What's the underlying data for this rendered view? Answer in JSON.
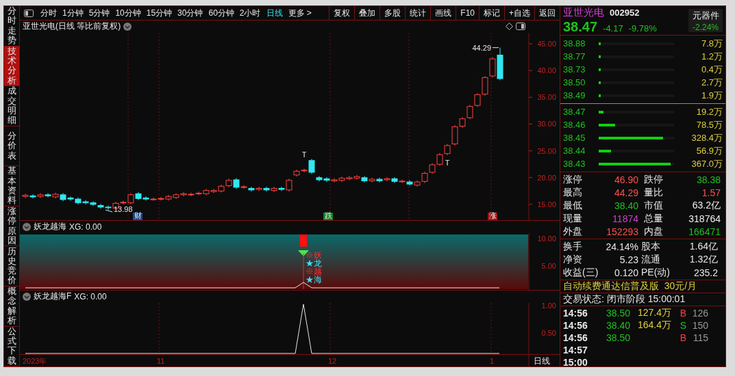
{
  "side_tabs": [
    {
      "label": "分时走势",
      "selected": false
    },
    {
      "label": "技术分析",
      "selected": true
    },
    {
      "label": "成交明细",
      "selected": false
    },
    {
      "label": "分价表",
      "selected": false
    },
    {
      "label": "基本资料",
      "selected": false
    },
    {
      "label": "涨停原因",
      "selected": false
    },
    {
      "label": "历史竞价",
      "selected": false
    },
    {
      "label": "概念解析",
      "selected": false
    },
    {
      "label": "公式下载",
      "selected": false
    }
  ],
  "periods": [
    {
      "label": "分时",
      "selected": false
    },
    {
      "label": "1分钟",
      "selected": false
    },
    {
      "label": "5分钟",
      "selected": false
    },
    {
      "label": "10分钟",
      "selected": false
    },
    {
      "label": "15分钟",
      "selected": false
    },
    {
      "label": "30分钟",
      "selected": false
    },
    {
      "label": "60分钟",
      "selected": false
    },
    {
      "label": "2小时",
      "selected": false
    },
    {
      "label": "日线",
      "selected": true
    }
  ],
  "more_label": "更多 >",
  "tool_buttons": [
    "复权",
    "叠加",
    "多股",
    "统计",
    "画线",
    "F10",
    "标记",
    "+自选",
    "返回"
  ],
  "main_chart": {
    "chart_data": {
      "type": "candlestick",
      "ohlc": [
        [
          16.5,
          17.0,
          16.2,
          16.7
        ],
        [
          16.6,
          16.9,
          16.1,
          16.4
        ],
        [
          16.5,
          17.1,
          16.2,
          16.8
        ],
        [
          16.8,
          17.1,
          16.3,
          16.6
        ],
        [
          16.4,
          17.2,
          16.1,
          16.9
        ],
        [
          16.8,
          17.1,
          15.6,
          15.9
        ],
        [
          16.2,
          16.5,
          15.7,
          16.0
        ],
        [
          16.0,
          16.3,
          15.0,
          15.3
        ],
        [
          15.5,
          15.8,
          15.0,
          15.3
        ],
        [
          15.3,
          15.6,
          14.7,
          15.0
        ],
        [
          14.8,
          15.1,
          14.2,
          14.5
        ],
        [
          14.5,
          14.8,
          13.98,
          14.4
        ],
        [
          14.3,
          15.5,
          14.0,
          15.2
        ],
        [
          15.3,
          15.7,
          15.0,
          15.4
        ],
        [
          15.3,
          17.1,
          15.0,
          16.8
        ],
        [
          17.0,
          17.3,
          15.8,
          16.1
        ],
        [
          16.2,
          16.5,
          15.7,
          16.0
        ],
        [
          16.0,
          16.3,
          15.7,
          16.0
        ],
        [
          16.0,
          16.4,
          15.7,
          16.1
        ],
        [
          16.0,
          16.8,
          15.7,
          16.5
        ],
        [
          16.3,
          17.1,
          16.0,
          16.8
        ],
        [
          16.8,
          17.3,
          16.5,
          17.0
        ],
        [
          16.8,
          17.2,
          16.5,
          16.9
        ],
        [
          17.0,
          17.4,
          16.7,
          17.1
        ],
        [
          17.0,
          17.9,
          16.7,
          17.6
        ],
        [
          17.4,
          17.9,
          17.1,
          17.6
        ],
        [
          17.5,
          18.7,
          17.2,
          18.4
        ],
        [
          18.5,
          19.8,
          18.2,
          19.5
        ],
        [
          19.6,
          19.9,
          17.9,
          18.2
        ],
        [
          18.2,
          18.6,
          17.9,
          18.3
        ],
        [
          18.0,
          18.3,
          17.4,
          17.7
        ],
        [
          17.8,
          18.3,
          17.5,
          18.0
        ],
        [
          18.0,
          18.3,
          17.4,
          17.7
        ],
        [
          17.6,
          18.3,
          17.3,
          18.0
        ],
        [
          18.0,
          18.3,
          17.5,
          17.8
        ],
        [
          17.7,
          19.8,
          17.4,
          19.5
        ],
        [
          20.5,
          21.5,
          20.2,
          21.2
        ],
        [
          21.3,
          21.7,
          21.0,
          21.4
        ],
        [
          23.2,
          23.5,
          20.7,
          21.0
        ],
        [
          20.0,
          20.3,
          19.3,
          19.6
        ],
        [
          19.8,
          20.1,
          19.2,
          19.5
        ],
        [
          19.4,
          19.9,
          19.1,
          19.6
        ],
        [
          19.5,
          20.2,
          19.2,
          19.9
        ],
        [
          19.8,
          20.3,
          19.5,
          20.0
        ],
        [
          19.9,
          20.5,
          19.6,
          20.2
        ],
        [
          20.0,
          20.3,
          19.1,
          19.4
        ],
        [
          19.4,
          20.0,
          19.1,
          19.7
        ],
        [
          19.7,
          20.0,
          19.1,
          19.4
        ],
        [
          19.6,
          20.1,
          19.3,
          19.8
        ],
        [
          19.8,
          20.1,
          19.0,
          19.3
        ],
        [
          19.3,
          19.65,
          19.0,
          19.35
        ],
        [
          19.2,
          19.5,
          18.5,
          18.8
        ],
        [
          18.6,
          19.5,
          18.3,
          19.2
        ],
        [
          19.3,
          21.1,
          19.0,
          20.8
        ],
        [
          21.0,
          22.7,
          20.7,
          22.4
        ],
        [
          22.5,
          24.6,
          22.2,
          24.3
        ],
        [
          24.5,
          26.3,
          24.2,
          26.0
        ],
        [
          26.3,
          29.8,
          26.0,
          29.5
        ],
        [
          29.6,
          31.3,
          29.3,
          31.0
        ],
        [
          31.2,
          33.6,
          30.9,
          33.3
        ],
        [
          33.5,
          35.8,
          33.2,
          35.5
        ],
        [
          35.6,
          39.0,
          35.3,
          38.7
        ],
        [
          39.0,
          42.5,
          38.7,
          42.2
        ],
        [
          42.9,
          44.29,
          38.2,
          38.5
        ]
      ]
    },
    "title": "亚世光电(日线 等比前复权)",
    "axis_labels": [
      "45.00",
      "40.00",
      "35.00",
      "30.00",
      "25.00",
      "20.00",
      "15.00"
    ],
    "high_label": "44.29",
    "low_label": "13.98",
    "marks": [
      "T",
      "T"
    ],
    "event_tags": [
      {
        "text": "财",
        "kind": "finance"
      },
      {
        "text": "跌",
        "kind": "down"
      },
      {
        "text": "涨",
        "kind": "up"
      }
    ]
  },
  "signal_panel": {
    "title": "妖龙越海",
    "reading": "XG: 0.00",
    "axis_labels": [
      "10.00",
      "5.00"
    ],
    "signal_texts": [
      {
        "text": "※妖",
        "color": "#ff3030"
      },
      {
        "text": "★龙",
        "color": "#40e0f0"
      },
      {
        "text": "※越",
        "color": "#ff3030"
      },
      {
        "text": "★海",
        "color": "#40e0f0"
      }
    ]
  },
  "spike_panel": {
    "title": "妖龙越海F",
    "reading": "XG: 0.00",
    "axis_labels": [
      "1.00",
      "0.50"
    ]
  },
  "date_axis": [
    "2023年",
    "11",
    "12",
    "1"
  ],
  "period_label": "日线",
  "quote": {
    "name": "亚世光电",
    "code": "002952",
    "sector": "元器件",
    "sector_change": "-2.24%",
    "price": "38.47",
    "change": "-4.17",
    "change_pct": "-9.78%"
  },
  "order_book": {
    "asks": [
      {
        "price": "38.88",
        "volume": "7.8万",
        "level": 0.03
      },
      {
        "price": "38.77",
        "volume": "1.2万",
        "level": 0.03
      },
      {
        "price": "38.73",
        "volume": "0.4万",
        "level": 0.03
      },
      {
        "price": "38.50",
        "volume": "2.7万",
        "level": 0.03
      },
      {
        "price": "38.49",
        "volume": "1.9万",
        "level": 0.03
      }
    ],
    "bids": [
      {
        "price": "38.47",
        "volume": "19.2万",
        "level": 0.06
      },
      {
        "price": "38.46",
        "volume": "78.5万",
        "level": 0.22
      },
      {
        "price": "38.45",
        "volume": "328.4万",
        "level": 0.85
      },
      {
        "price": "38.44",
        "volume": "56.9万",
        "level": 0.16
      },
      {
        "price": "38.43",
        "volume": "367.0万",
        "level": 0.95
      }
    ]
  },
  "stats": [
    {
      "label": "涨停",
      "value": "46.90",
      "color": "#ff5050"
    },
    {
      "label": "跌停",
      "value": "38.38",
      "color": "#20c020"
    },
    {
      "label": "最高",
      "value": "44.29",
      "color": "#ff5050"
    },
    {
      "label": "量比",
      "value": "1.57",
      "color": "#ff5050"
    },
    {
      "label": "最低",
      "value": "38.40",
      "color": "#20c020"
    },
    {
      "label": "市值",
      "value": "63.2亿",
      "color": "#f0f0f0"
    },
    {
      "label": "现量",
      "value": "11874",
      "color": "#d040d0"
    },
    {
      "label": "总量",
      "value": "318764",
      "color": "#f0f0f0"
    },
    {
      "label": "外盘",
      "value": "152293",
      "color": "#ff5050"
    },
    {
      "label": "内盘",
      "value": "166471",
      "color": "#20c020"
    }
  ],
  "fundamentals": [
    {
      "label": "换手",
      "value": "24.14%",
      "label2": "股本",
      "value2": "1.64亿"
    },
    {
      "label": "净资",
      "value": "5.23",
      "label2": "流通",
      "value2": "1.32亿"
    },
    {
      "label": "收益(三)",
      "value": "0.120",
      "label2": "PE(动)",
      "value2": "235.2"
    }
  ],
  "banner": "自动续费通达信普及版  30元/月",
  "status": "交易状态: 闭市阶段 15:00:01",
  "trades": [
    {
      "time": "14:56",
      "price": "38.50",
      "volume": "127.4万",
      "side": "B",
      "count": "126"
    },
    {
      "time": "14:56",
      "price": "38.40",
      "volume": "164.4万",
      "side": "S",
      "count": "150"
    },
    {
      "time": "14:56",
      "price": "38.50",
      "side": "B",
      "count": "115"
    },
    {
      "time": "14:57"
    },
    {
      "time": "15:00"
    }
  ]
}
